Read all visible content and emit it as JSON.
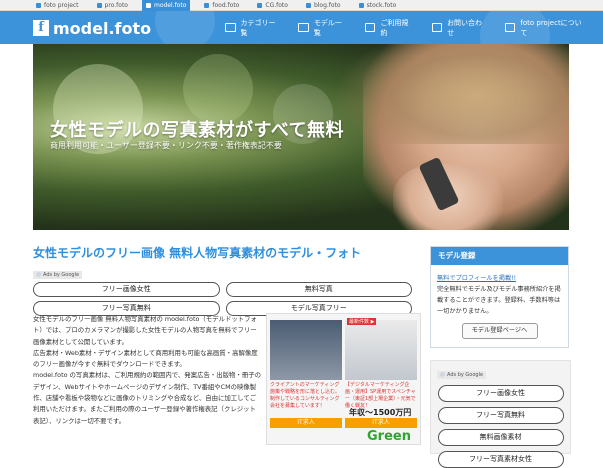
{
  "topbar": {
    "sites": [
      {
        "label": "foto project",
        "active": false
      },
      {
        "label": "pro.foto",
        "active": false
      },
      {
        "label": "model.foto",
        "active": true
      },
      {
        "label": "food.foto",
        "active": false
      },
      {
        "label": "CG.foto",
        "active": false
      },
      {
        "label": "blog.foto",
        "active": false
      },
      {
        "label": "stock.foto",
        "active": false
      }
    ]
  },
  "header": {
    "logo_mark": "f",
    "logo_text": "model.foto",
    "nav": [
      {
        "label": "カテゴリー覧",
        "icon": "image-icon"
      },
      {
        "label": "モデル一覧",
        "icon": "image-icon"
      },
      {
        "label": "ご利用規約",
        "icon": "document-icon"
      },
      {
        "label": "お問い合わせ",
        "icon": "mail-icon"
      },
      {
        "label": "foto projectについて",
        "icon": "foto-icon"
      }
    ]
  },
  "hero": {
    "title": "女性モデルの写真素材がすべて無料",
    "subtitle": "商用利用可能・ユーザー登録不要・リンク不要・著作権表記不要"
  },
  "main": {
    "title": "女性モデルのフリー画像 無料人物写真素材のモデル・フォト",
    "ads_label": "Ads by Google",
    "links": [
      "フリー画像女性",
      "無料写真",
      "フリー写真無料",
      "モデル写真フリー"
    ],
    "paragraphs": [
      "女性モデルのフリー画像 無料人物写真素材の model.foto（モデルドットフォト）では、プロのカメラマンが撮影した女性モデルの人物写真を無料でフリー画像素材として公開しています。",
      "広告素材・Web素材・デザイン素材として商用利用も可能な高画質・高解像度のフリー画像が今すぐ無料でダウンロードできます。",
      "model.foto の写真素材は、ご利用規約の範囲内で、発案広告・出版物・冊子のデザイン、Webサイトやホームページのデザイン制作、TV番組やCMの映像製作、店舗や看板や袋物などに画像のトリミングや合成など、自由に加工してご利用いただけます。またご利用の際のユーザー登録や著作権表記（クレジット表記）、リンクは一切不要です。"
    ]
  },
  "ad": {
    "tag": "最新件数 ▶",
    "cap_left": "クライアントのマーケティング施策や戦略を形に落とし込む。制作しているコンサルティング会社を募集しています！",
    "cap_right": "【デジタルマーケティング企画・運用】SP運用でスペンチャー（東証1部上場企業）・元気で働く戦友！",
    "price": "年収〜1500万円",
    "it_left": "IT求人",
    "it_right": "IT求人",
    "brand": "Green"
  },
  "sidebar": {
    "register_title": "モデル登録",
    "register_link": "無料でプロフィールを掲載!!",
    "register_text": "完全無料でモデル及びモデル事務所紹介を掲載することができます。登録料、手数料等は一切かかりません。",
    "register_button": "モデル登録ページへ",
    "ads_label": "Ads by Google",
    "links": [
      "フリー画像女性",
      "フリー写真無料",
      "無料画像素材",
      "フリー写真素材女性"
    ]
  },
  "colors": {
    "brand": "#3d93da",
    "title": "#2f8fdd",
    "link": "#2b6fb8"
  }
}
